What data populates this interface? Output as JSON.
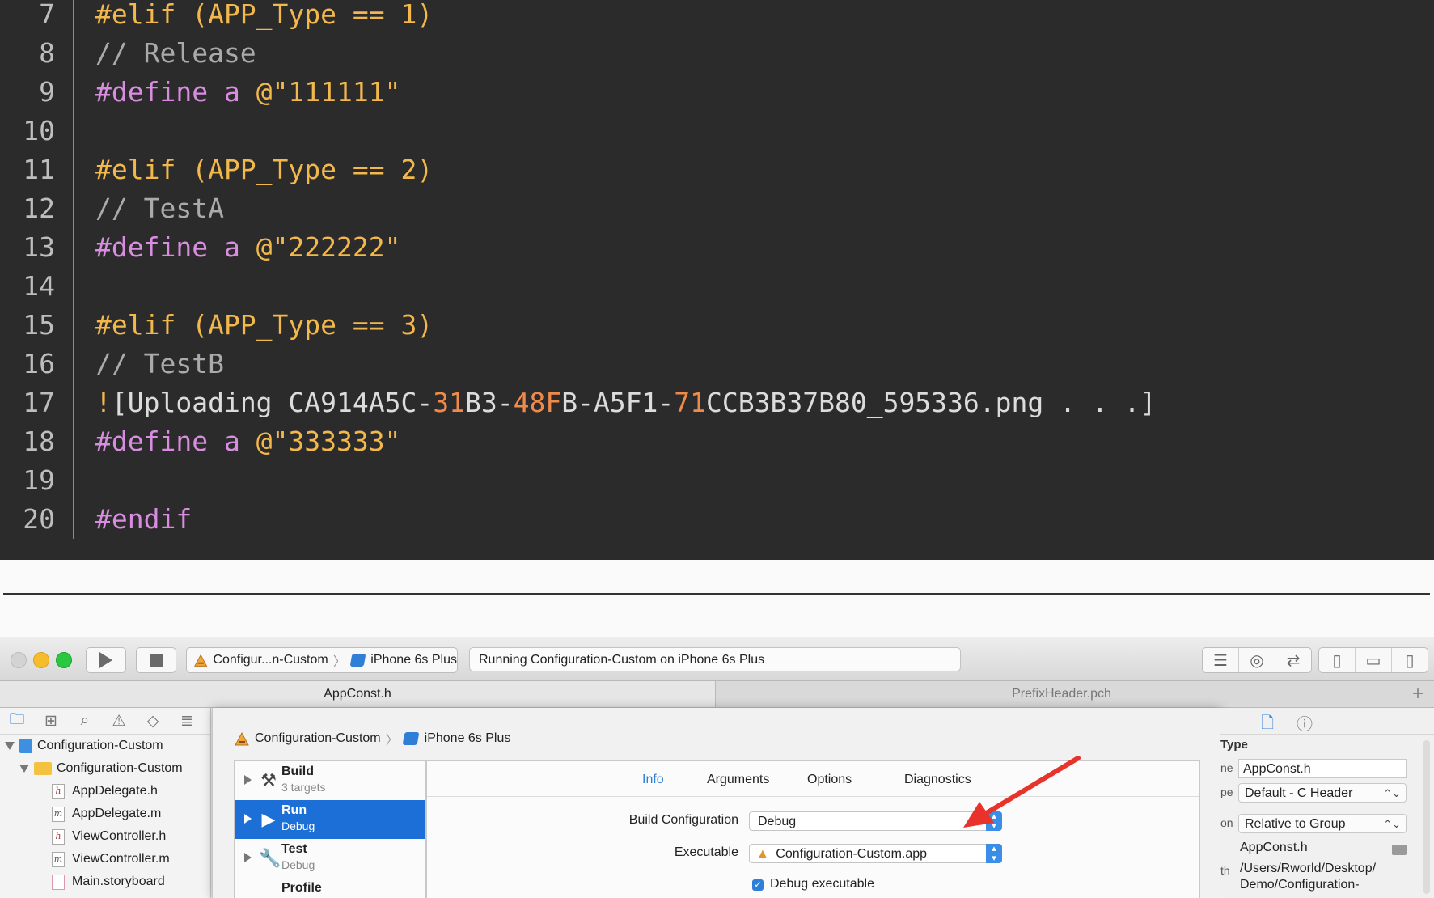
{
  "code": {
    "lines": [
      {
        "num": "7",
        "tokens": [
          {
            "t": "#elif (APP_Type == 1)",
            "c": "pre"
          }
        ]
      },
      {
        "num": "8",
        "tokens": [
          {
            "t": "// Release",
            "c": "com"
          }
        ]
      },
      {
        "num": "9",
        "tokens": [
          {
            "t": "#define a ",
            "c": "def"
          },
          {
            "t": "@\"111111\"",
            "c": "str"
          }
        ]
      },
      {
        "num": "10",
        "tokens": []
      },
      {
        "num": "11",
        "tokens": [
          {
            "t": "#elif (APP_Type == 2)",
            "c": "pre"
          }
        ]
      },
      {
        "num": "12",
        "tokens": [
          {
            "t": "// TestA",
            "c": "com"
          }
        ]
      },
      {
        "num": "13",
        "tokens": [
          {
            "t": "#define a ",
            "c": "def"
          },
          {
            "t": "@\"222222\"",
            "c": "str"
          }
        ]
      },
      {
        "num": "14",
        "tokens": []
      },
      {
        "num": "15",
        "tokens": [
          {
            "t": "#elif (APP_Type == 3)",
            "c": "pre"
          }
        ]
      },
      {
        "num": "16",
        "tokens": [
          {
            "t": "// TestB",
            "c": "com"
          }
        ]
      },
      {
        "num": "17",
        "tokens": [
          {
            "t": "!",
            "c": "acc"
          },
          {
            "t": "[Uploading CA914A5C-",
            "c": "plain"
          },
          {
            "t": "31",
            "c": "num"
          },
          {
            "t": "B3-",
            "c": "plain"
          },
          {
            "t": "48F",
            "c": "num"
          },
          {
            "t": "B-A5F1-",
            "c": "plain"
          },
          {
            "t": "71",
            "c": "num"
          },
          {
            "t": "CCB3B37B80_595336.png . . .]",
            "c": "plain"
          }
        ]
      },
      {
        "num": "18",
        "tokens": [
          {
            "t": "#define a ",
            "c": "def"
          },
          {
            "t": "@\"333333\"",
            "c": "str"
          }
        ]
      },
      {
        "num": "19",
        "tokens": []
      },
      {
        "num": "20",
        "tokens": [
          {
            "t": "#endif",
            "c": "def"
          }
        ]
      }
    ]
  },
  "toolbar": {
    "scheme_name": "Configur...n-Custom",
    "device": "iPhone 6s Plus",
    "status": "Running Configuration-Custom on iPhone 6s Plus"
  },
  "tabs": {
    "active": "AppConst.h",
    "inactive": "PrefixHeader.pch",
    "add": "+"
  },
  "navigator": {
    "project": "Configuration-Custom",
    "group": "Configuration-Custom",
    "files": [
      {
        "badge": "h",
        "name": "AppDelegate.h"
      },
      {
        "badge": "m",
        "name": "AppDelegate.m"
      },
      {
        "badge": "h",
        "name": "ViewController.h"
      },
      {
        "badge": "m",
        "name": "ViewController.m"
      },
      {
        "badge": "",
        "name": "Main.storyboard"
      }
    ]
  },
  "scheme_editor": {
    "breadcrumb_scheme": "Configuration-Custom",
    "breadcrumb_device": "iPhone 6s Plus",
    "actions": [
      {
        "title": "Build",
        "subtitle": "3 targets"
      },
      {
        "title": "Run",
        "subtitle": "Debug"
      },
      {
        "title": "Test",
        "subtitle": "Debug"
      },
      {
        "title": "Profile",
        "subtitle": ""
      }
    ],
    "tabs": [
      "Info",
      "Arguments",
      "Options",
      "Diagnostics"
    ],
    "build_configuration_label": "Build Configuration",
    "build_configuration_value": "Debug",
    "executable_label": "Executable",
    "executable_value": "Configuration-Custom.app",
    "debug_executable_label": "Debug executable"
  },
  "inspector": {
    "section": "Type",
    "name_label_cut": "ne",
    "name_value": "AppConst.h",
    "type_label_cut": "pe",
    "type_value": "Default - C Header",
    "location_label_cut": "on",
    "location_value": "Relative to Group",
    "file_name": "AppConst.h",
    "path_label_cut": "th",
    "path_line1": "/Users/Rworld/Desktop/",
    "path_line2": "Demo/Configuration-"
  },
  "colors": {
    "code_bg": "#2b2b2b",
    "preprocessor": "#f2b84c",
    "comment": "#aaaaaa",
    "define": "#d98de0",
    "number": "#f08a4b",
    "selection": "#1b6fd6",
    "arrow": "#e8322a"
  }
}
